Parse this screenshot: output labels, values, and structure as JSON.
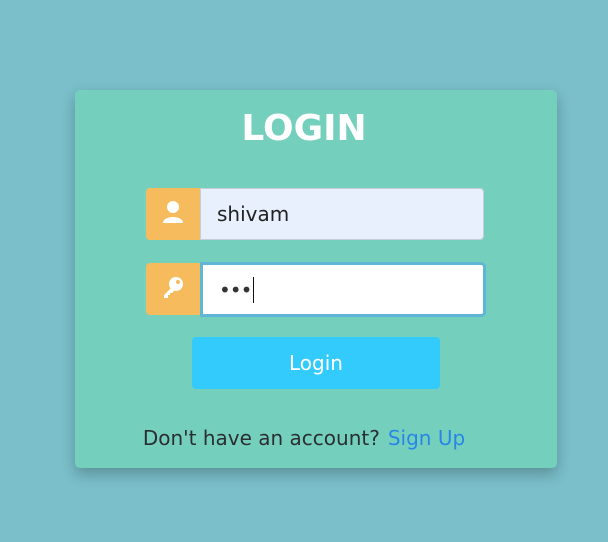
{
  "login": {
    "title": "LOGIN",
    "username_value": "shivam",
    "password_masked": "•••",
    "submit_label": "Login",
    "footer_text": "Don't have an account?",
    "signup_link": "Sign Up"
  },
  "icons": {
    "user": "user-icon",
    "password": "key-icon"
  },
  "colors": {
    "background": "#7abfca",
    "card": "#74d0bd",
    "icon_box": "#f6bb5d",
    "button": "#33cafc",
    "link": "#2a86e6"
  }
}
